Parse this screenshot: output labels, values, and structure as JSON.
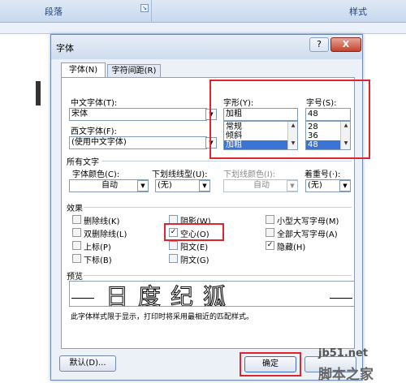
{
  "ribbon": {
    "group_paragraph": "段落",
    "group_styles": "样式"
  },
  "dialog": {
    "title": "字体",
    "help_label": "?",
    "close_label": "X",
    "tabs": [
      {
        "label": "字体(N)"
      },
      {
        "label": "字符间距(R)"
      }
    ],
    "chinese_font": {
      "label": "中文字体(T):",
      "value": "宋体"
    },
    "western_font": {
      "label": "西文字体(F):",
      "value": "(使用中文字体)"
    },
    "style": {
      "label": "字形(Y):",
      "value": "加粗",
      "options": [
        "常规",
        "倾斜",
        "加粗"
      ],
      "selected": "加粗"
    },
    "size": {
      "label": "字号(S):",
      "value": "48",
      "options": [
        "28",
        "36",
        "48"
      ],
      "selected": "48"
    },
    "all_text": {
      "header": "所有文字",
      "font_color": {
        "label": "字体颜色(C):",
        "value": "自动"
      },
      "underline_type": {
        "label": "下划线线型(U):",
        "value": "(无)"
      },
      "underline_color": {
        "label": "下划线颜色(I):",
        "value": "自动"
      },
      "emphasis": {
        "label": "着重号(·):",
        "value": "(无)"
      }
    },
    "effects": {
      "header": "效果",
      "items": [
        {
          "label": "删除线(K)",
          "checked": false
        },
        {
          "label": "双删除线(L)",
          "checked": false
        },
        {
          "label": "上标(P)",
          "checked": false
        },
        {
          "label": "下标(B)",
          "checked": false
        },
        {
          "label": "阴影(W)",
          "checked": false
        },
        {
          "label": "空心(O)",
          "checked": true
        },
        {
          "label": "阳文(E)",
          "checked": false
        },
        {
          "label": "阴文(G)",
          "checked": false
        },
        {
          "label": "小型大写字母(M)",
          "checked": false
        },
        {
          "label": "全部大写字母(A)",
          "checked": false
        },
        {
          "label": "隐藏(H)",
          "checked": true
        }
      ],
      "check_mark": "✓"
    },
    "preview": {
      "header": "预览",
      "sample": "日度纪狐"
    },
    "note": "此字体样式限于显示，打印时将采用最相近的匹配样式。",
    "default_button": "默认(D)...",
    "ok_button": "确定",
    "cancel_button": ""
  },
  "watermark": {
    "line1": "jb51.net",
    "line2": "脚本之家"
  },
  "highlight_color": "#e0232e",
  "selection_color": "#3c74d6"
}
